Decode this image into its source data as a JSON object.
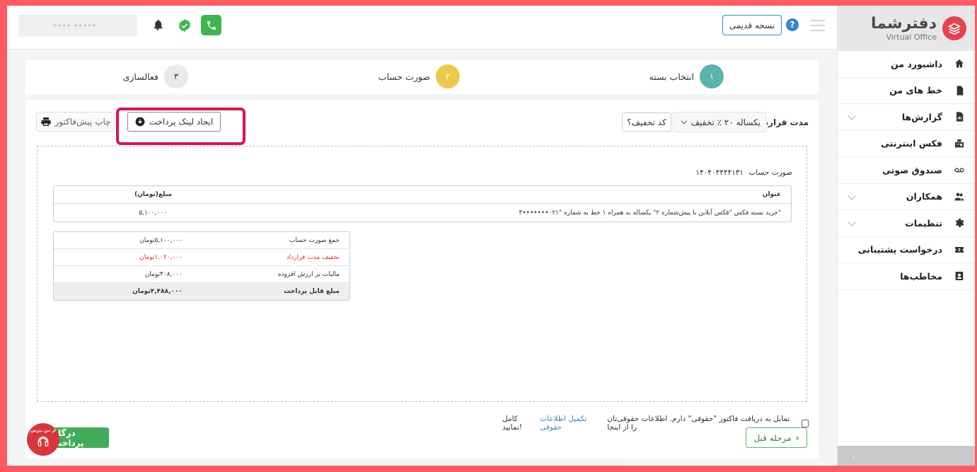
{
  "brand": {
    "name": "دفترشما",
    "subtitle": "Virtual Office"
  },
  "sidebar": {
    "items": [
      {
        "label": "داشبورد من",
        "icon": "home-icon",
        "has_submenu": false
      },
      {
        "label": "خط های من",
        "icon": "sim-card-icon",
        "has_submenu": false
      },
      {
        "label": "گزارش‌ها",
        "icon": "report-icon",
        "has_submenu": true
      },
      {
        "label": "فکس اینترنتی",
        "icon": "fax-icon",
        "has_submenu": false
      },
      {
        "label": "صندوق صوتی",
        "icon": "voicemail-icon",
        "has_submenu": false
      },
      {
        "label": "همکاران",
        "icon": "people-icon",
        "has_submenu": true
      },
      {
        "label": "تنظیمات",
        "icon": "gear-icon",
        "has_submenu": true
      },
      {
        "label": "درخواست پشتیبانی",
        "icon": "ticket-icon",
        "has_submenu": false
      },
      {
        "label": "مخاطب‌ها",
        "icon": "contact-card-icon",
        "has_submenu": false
      }
    ],
    "footer_arrow": "›"
  },
  "topbar": {
    "account_field": "•••• ••••• ۰",
    "old_version_label": "نسخه قدیمی",
    "help_label": "?"
  },
  "stepper": {
    "steps": [
      {
        "number": "۱",
        "label": "انتخاب بسته",
        "color": "#5bb3ad"
      },
      {
        "number": "۲",
        "label": "صورت حساب",
        "color": "#ecc94b"
      },
      {
        "number": "۳",
        "label": "فعالسازی",
        "color": "#e9e9e9"
      }
    ]
  },
  "contract": {
    "label": "مدت قرارداد",
    "selected_option": "یکساله ۲۰ ٪ تخفیف",
    "discount_code_label": "کد تخفیف؟",
    "payment_link_label": "ایجاد لینک پرداخت",
    "print_label": "چاپ پیش‌فاکتور"
  },
  "invoice": {
    "title": "صورت حساب",
    "number": "۱۴۰۴۰۴۴۴۴۱۳۱",
    "items_headers": {
      "title": "عنوان",
      "amount": "مبلغ(تومان)"
    },
    "items": [
      {
        "title": "خرید بسته فکس \"فکس آنلاین با پیش‌شماره ۲\" یکساله به همراه ۱ خط به شماره \"۰۲۱•••••••۳\"",
        "amount": "۵,۱۰۰,۰۰۰"
      }
    ],
    "summary": [
      {
        "label": "جمع صورت حساب",
        "value": "۵,۱۰۰,۰۰۰تومان",
        "style": "normal"
      },
      {
        "label": "تخفیف مدت قرارداد",
        "value": "۱,۰۲۰,۰۰۰تومان",
        "style": "red"
      },
      {
        "label": "مالیات بر ارزش افزوده",
        "value": "۴۰۸,۰۰۰تومان",
        "style": "normal"
      },
      {
        "label": "مبلغ قابل پرداخت",
        "value": "۴,۴۸۸,۰۰۰تومان",
        "style": "total"
      }
    ]
  },
  "footer": {
    "legal_text": "تمایل به دریافت فاکتور \"حقوقی\" دارم. اطلاعات حقوقی‌تان را از اینجا",
    "legal_link": "تکمیل اطلاعات حقوقی",
    "legal_suffix": "کامل نمایید!",
    "prev_step_label": "مرحله قبل",
    "gateway_label": "درگاه پرداخت",
    "support_label": "از من بپرس"
  },
  "colors": {
    "accent_red": "#e8424d",
    "green": "#41ad58",
    "blue": "#3b86c5",
    "highlight": "#d6164e"
  }
}
